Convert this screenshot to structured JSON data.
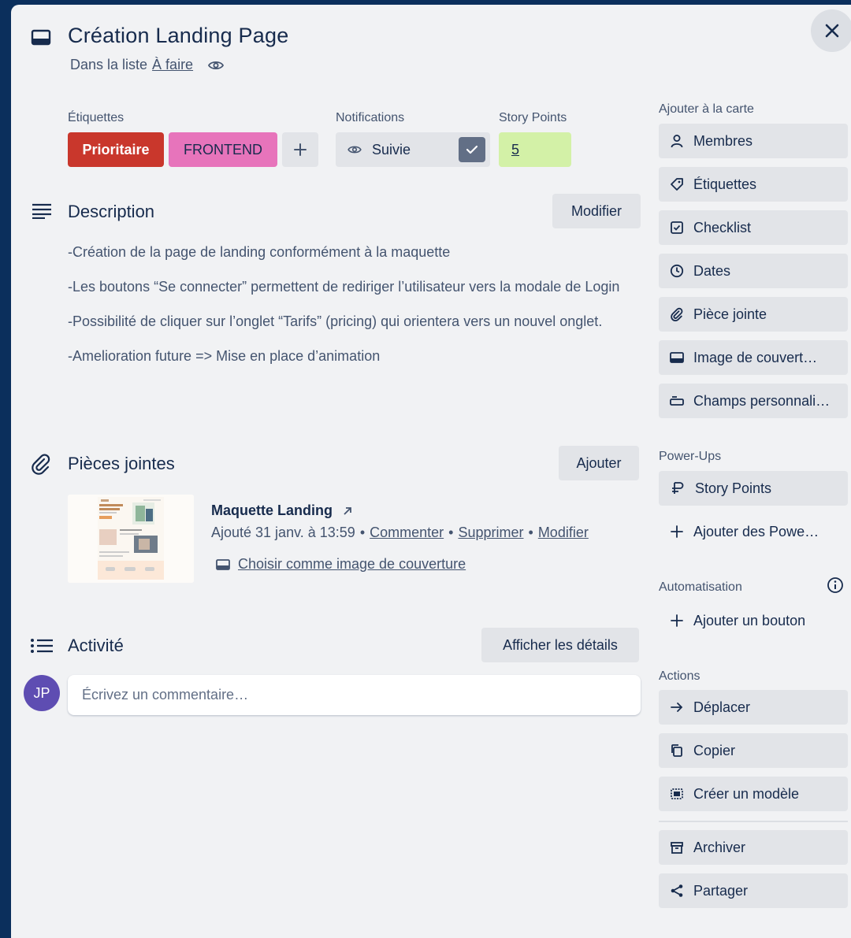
{
  "card": {
    "title": "Création Landing Page",
    "list_prefix": "Dans la liste",
    "list_name": "À faire"
  },
  "labels": {
    "section_label": "Étiquettes",
    "items": [
      {
        "text": "Prioritaire",
        "color": "#c9372c"
      },
      {
        "text": "FRONTEND",
        "color": "#e774bb"
      }
    ]
  },
  "notifications": {
    "section_label": "Notifications",
    "button_label": "Suivie"
  },
  "story_points": {
    "section_label": "Story Points",
    "value": "5",
    "color": "#d3f1a7"
  },
  "description": {
    "heading": "Description",
    "edit_label": "Modifier",
    "paragraphs": [
      "-Création de la page de landing conformément à la maquette",
      "-Les boutons “Se connecter” permettent de rediriger l’utilisateur vers la modale de Login",
      "-Possibilité de cliquer sur l’onglet “Tarifs” (pricing) qui orientera vers un nouvel onglet.",
      "-Amelioration future => Mise en place d’animation"
    ]
  },
  "attachments": {
    "heading": "Pièces jointes",
    "add_label": "Ajouter",
    "item": {
      "name": "Maquette Landing",
      "added": "Ajouté 31 janv. à 13:59",
      "comment": "Commenter",
      "delete": "Supprimer",
      "edit": "Modifier",
      "cover": "Choisir comme image de couverture",
      "separator": "•"
    }
  },
  "activity": {
    "heading": "Activité",
    "details_label": "Afficher les détails",
    "avatar_initials": "JP",
    "avatar_color": "#5e4db2",
    "comment_placeholder": "Écrivez un commentaire…"
  },
  "sidebar": {
    "add_to_card_label": "Ajouter à la carte",
    "add_to_card": [
      {
        "label": "Membres",
        "icon": "person-icon"
      },
      {
        "label": "Étiquettes",
        "icon": "tag-icon"
      },
      {
        "label": "Checklist",
        "icon": "checklist-icon"
      },
      {
        "label": "Dates",
        "icon": "clock-icon"
      },
      {
        "label": "Pièce jointe",
        "icon": "paperclip-icon"
      },
      {
        "label": "Image de couvert…",
        "icon": "card-cover-icon"
      },
      {
        "label": "Champs personnali…",
        "icon": "custom-fields-icon"
      }
    ],
    "powerups_label": "Power-Ups",
    "powerup_story_points": "Story Points",
    "add_powerups": "Ajouter des Powe…",
    "automation_label": "Automatisation",
    "add_button": "Ajouter un bouton",
    "actions_label": "Actions",
    "actions": [
      {
        "label": "Déplacer",
        "icon": "arrow-right-icon"
      },
      {
        "label": "Copier",
        "icon": "copy-icon"
      },
      {
        "label": "Créer un modèle",
        "icon": "template-icon"
      }
    ],
    "archive": "Archiver",
    "share": "Partager"
  }
}
